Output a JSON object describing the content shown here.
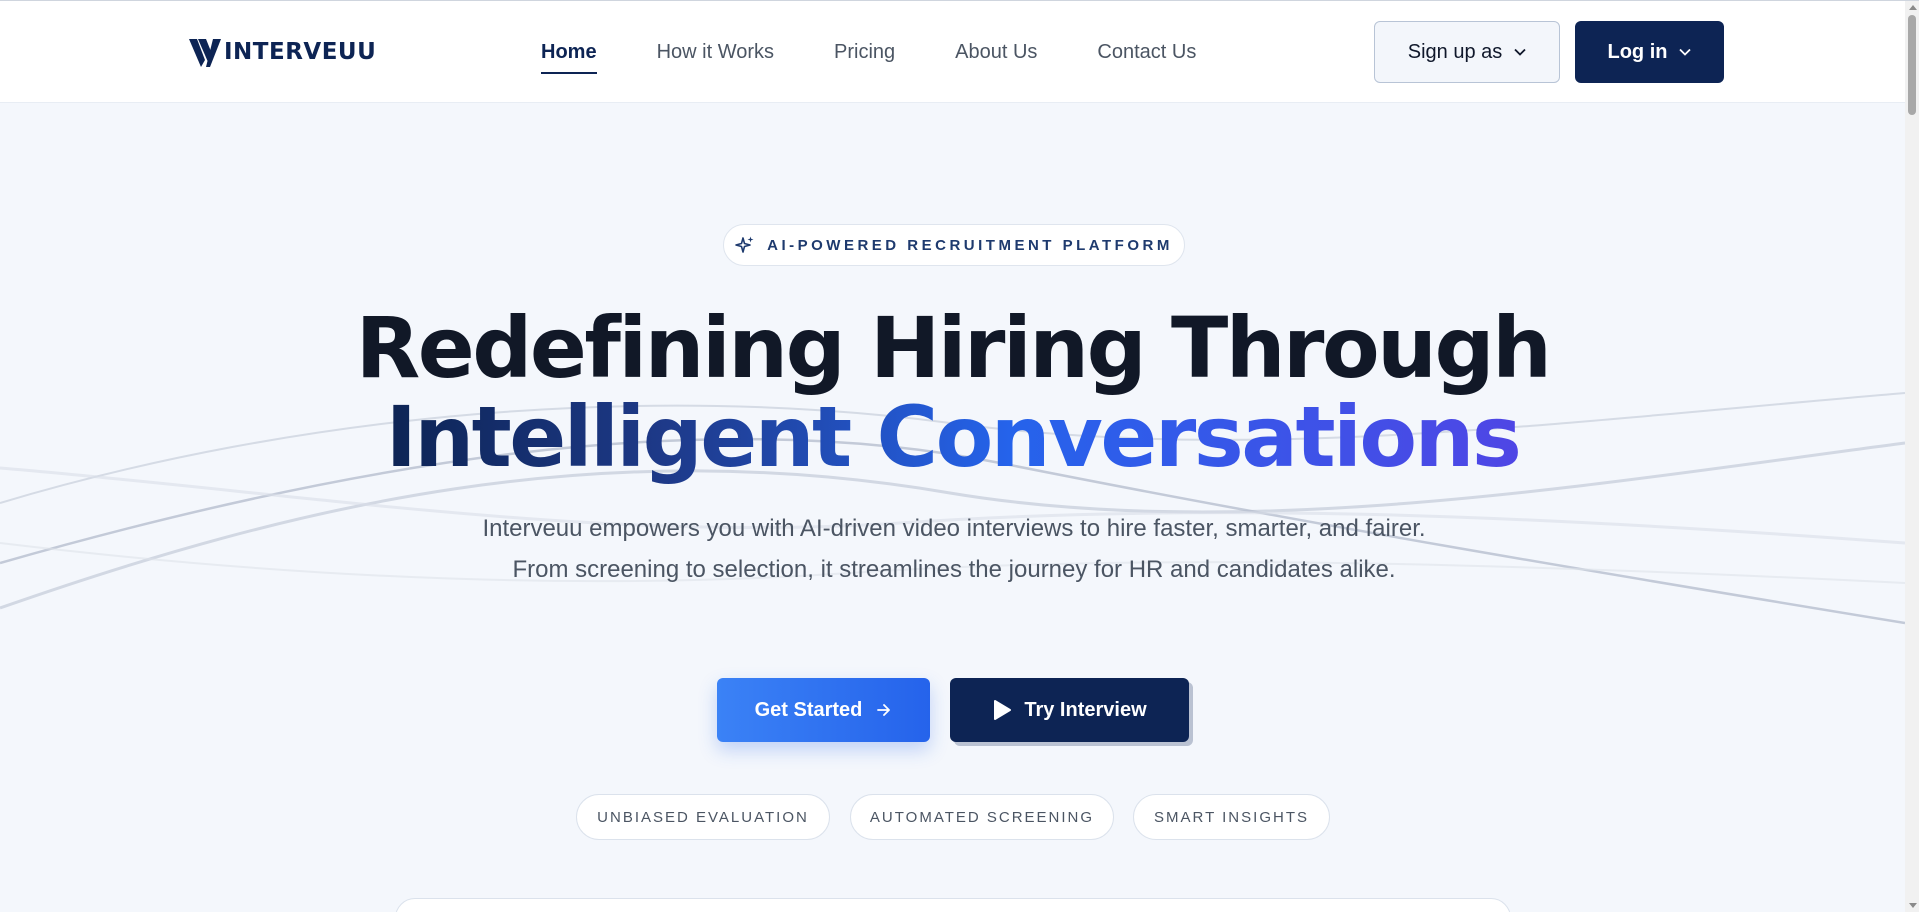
{
  "brand": {
    "name": "INTERVEUU",
    "icon": "interveuu-logo-mark",
    "color": "#0d2454"
  },
  "nav": {
    "items": [
      {
        "label": "Home",
        "active": true
      },
      {
        "label": "How it Works",
        "active": false
      },
      {
        "label": "Pricing",
        "active": false
      },
      {
        "label": "About Us",
        "active": false
      },
      {
        "label": "Contact Us",
        "active": false
      }
    ]
  },
  "header": {
    "signup_label": "Sign up as",
    "login_label": "Log in"
  },
  "hero": {
    "badge_label": "AI-POWERED RECRUITMENT PLATFORM",
    "badge_icon": "sparkles-icon",
    "headline_line1": "Redefining Hiring Through",
    "headline_line2": "Intelligent Conversations",
    "subtitle": "Interveuu empowers you with AI-driven video interviews to hire faster, smarter, and fairer. From screening to selection, it streamlines the journey for HR and candidates alike.",
    "cta_primary": "Get Started",
    "cta_secondary": "Try Interview",
    "tags": [
      "UNBIASED EVALUATION",
      "AUTOMATED SCREENING",
      "SMART INSIGHTS"
    ]
  },
  "colors": {
    "primary_dark": "#0d2454",
    "accent_blue": "#2563eb",
    "accent_indigo": "#4f46e5",
    "background": "#f4f7fc"
  }
}
